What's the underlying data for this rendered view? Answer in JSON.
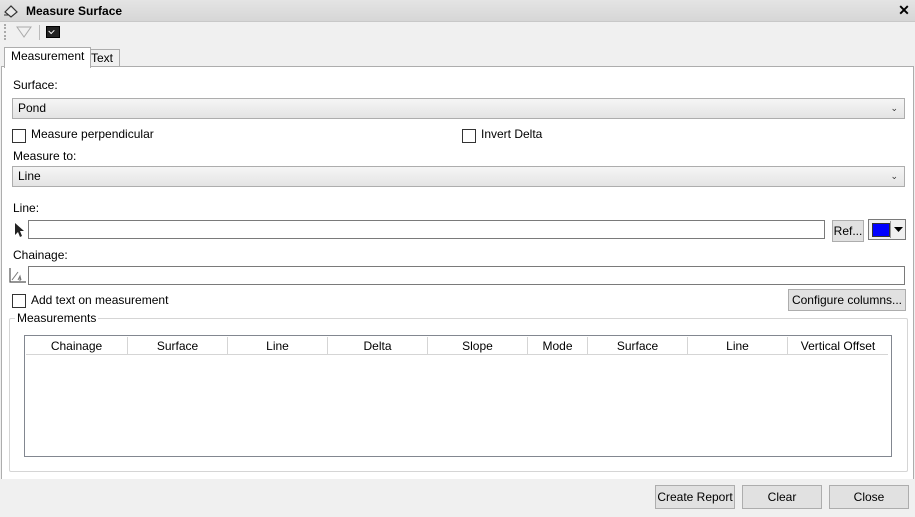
{
  "window": {
    "title": "Measure Surface",
    "close_symbol": "✕"
  },
  "tabs": [
    {
      "label": "Measurement"
    },
    {
      "label": "Text"
    }
  ],
  "surface": {
    "label": "Surface:",
    "value": "Pond"
  },
  "options": {
    "measure_perpendicular": "Measure perpendicular",
    "invert_delta": "Invert Delta"
  },
  "measure_to": {
    "label": "Measure to:",
    "value": "Line"
  },
  "line": {
    "label": "Line:",
    "value": "",
    "ref_button": "Ref...",
    "color": "#0000ff"
  },
  "chainage": {
    "label": "Chainage:",
    "value": ""
  },
  "add_text": {
    "label": "Add text on measurement"
  },
  "configure_button": "Configure columns...",
  "measurements": {
    "title": "Measurements",
    "columns": [
      "Chainage",
      "Surface",
      "Line",
      "Delta",
      "Slope",
      "Mode",
      "Surface",
      "Line",
      "Vertical Offset"
    ]
  },
  "footer": {
    "create_report": "Create Report",
    "clear": "Clear",
    "close": "Close"
  },
  "icons": {
    "title": "eraser-icon",
    "filter": "filter-icon",
    "terminal": "console-icon",
    "pick": "cursor-arrow-icon",
    "chainage": "chainage-icon",
    "dropdown": "chevron-down-icon"
  }
}
